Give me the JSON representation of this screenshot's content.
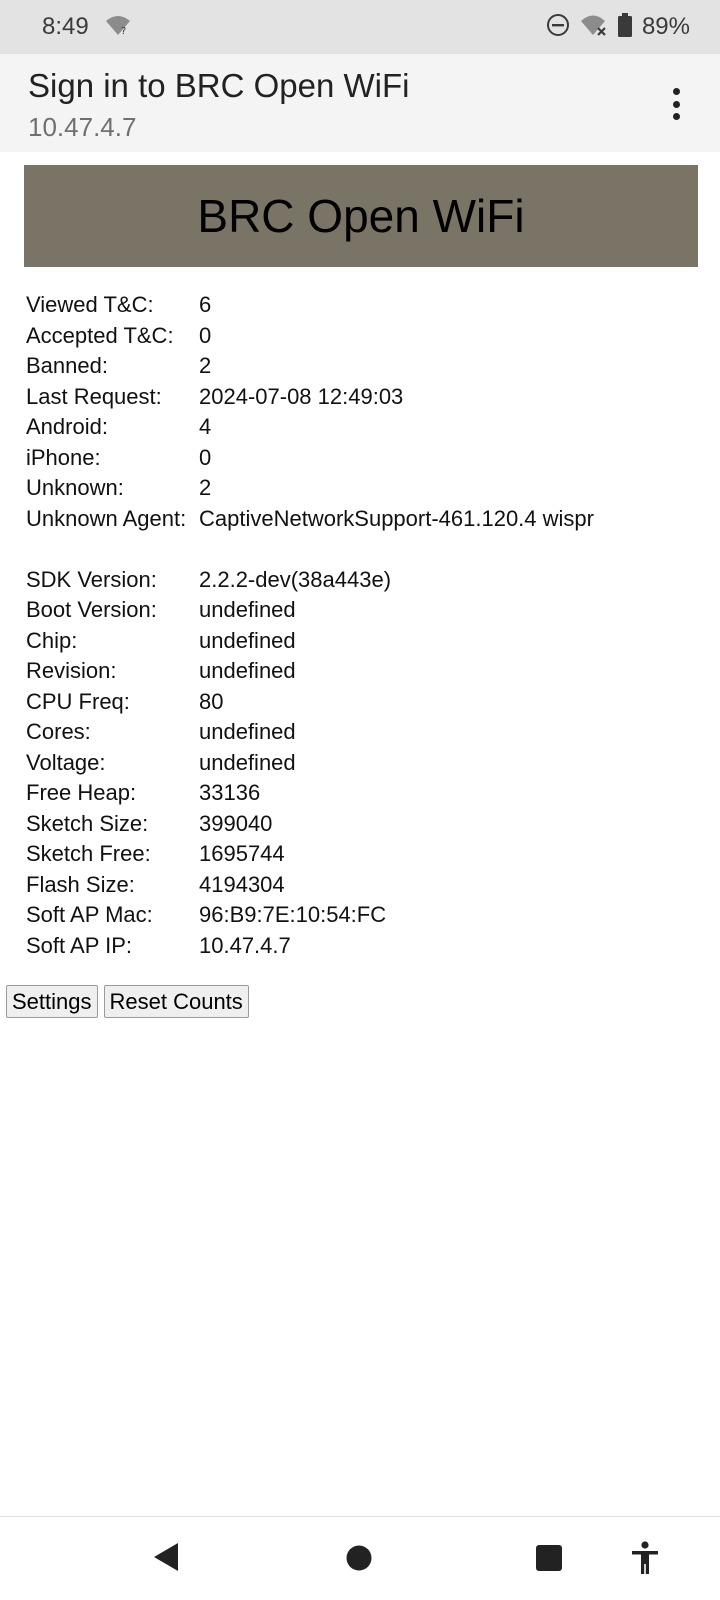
{
  "status_bar": {
    "time": "8:49",
    "battery": "89%",
    "icons": [
      "wifi-question-icon",
      "do-not-disturb-icon",
      "wifi-off-icon",
      "battery-icon"
    ]
  },
  "header": {
    "title": "Sign in to BRC Open WiFi",
    "url": "10.47.4.7",
    "menu_icon": "more-vert-icon"
  },
  "page": {
    "banner": "BRC Open WiFi",
    "stats": [
      {
        "label": "Viewed T&C:",
        "value": "6"
      },
      {
        "label": "Accepted T&C:",
        "value": "0"
      },
      {
        "label": "Banned:",
        "value": "2"
      },
      {
        "label": "Last Request:",
        "value": "2024-07-08 12:49:03"
      },
      {
        "label": "Android:",
        "value": "4"
      },
      {
        "label": "iPhone:",
        "value": "0"
      },
      {
        "label": "Unknown:",
        "value": "2"
      },
      {
        "label": "Unknown Agent:",
        "value": "CaptiveNetworkSupport-461.120.4 wispr"
      }
    ],
    "system": [
      {
        "label": "SDK Version:",
        "value": "2.2.2-dev(38a443e)"
      },
      {
        "label": "Boot Version:",
        "value": "undefined"
      },
      {
        "label": "Chip:",
        "value": "undefined"
      },
      {
        "label": "Revision:",
        "value": "undefined"
      },
      {
        "label": "CPU Freq:",
        "value": "80"
      },
      {
        "label": "Cores:",
        "value": "undefined"
      },
      {
        "label": "Voltage:",
        "value": "undefined"
      },
      {
        "label": "Free Heap:",
        "value": "33136"
      },
      {
        "label": "Sketch Size:",
        "value": "399040"
      },
      {
        "label": "Sketch Free:",
        "value": "1695744"
      },
      {
        "label": "Flash Size:",
        "value": "4194304"
      },
      {
        "label": "Soft AP Mac:",
        "value": "96:B9:7E:10:54:FC"
      },
      {
        "label": "Soft AP IP:",
        "value": "10.47.4.7"
      }
    ],
    "buttons": {
      "settings": "Settings",
      "reset": "Reset Counts"
    }
  },
  "nav_bar": {
    "icons": [
      "back-icon",
      "home-icon",
      "recents-icon",
      "accessibility-icon"
    ]
  }
}
